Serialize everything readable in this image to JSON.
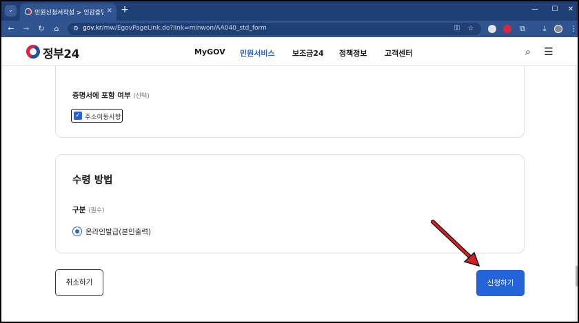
{
  "browser": {
    "tab_menu_icon": "chevron-down-icon",
    "tab_title": "민원신청서작성 > 인감증명서",
    "tab_close": "×",
    "new_tab": "+",
    "window_controls": {
      "minimize": "—",
      "maximize": "☐",
      "close": "✕"
    },
    "url_host": "gov.kr",
    "url_path": "/mw/EgovPageLink.do?link=minwon/AA040_std_form",
    "nav": {
      "back": "←",
      "forward": "→",
      "reload": "↻",
      "home": "⌂"
    }
  },
  "header": {
    "logo_text": "정부24",
    "nav_items": [
      {
        "label": "MyGOV",
        "active": false
      },
      {
        "label": "민원서비스",
        "active": true
      },
      {
        "label": "보조금24",
        "active": false
      },
      {
        "label": "정책정보",
        "active": false
      },
      {
        "label": "고객센터",
        "active": false
      }
    ],
    "search_icon": "search-icon",
    "menu_icon": "hamburger-menu-icon"
  },
  "certificate_section": {
    "label": "증명서에 포함 여부",
    "optional_note": "(선택)",
    "checkbox_label": "주소이동사항",
    "checked": true
  },
  "receipt_section": {
    "title": "수령 방법",
    "category_label": "구분",
    "required_note": "(필수)",
    "radio_label": "온라인발급(본인출력)",
    "selected": true
  },
  "actions": {
    "cancel_label": "취소하기",
    "submit_label": "신청하기"
  },
  "colors": {
    "accent": "#2563d8",
    "browser_dark": "#1f3f75",
    "browser_toolbar": "#30548f",
    "annotation_arrow": "#d32020"
  }
}
